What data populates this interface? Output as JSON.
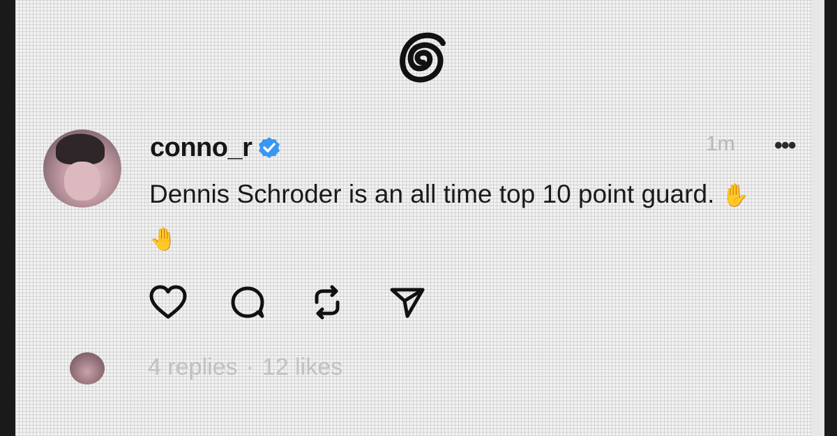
{
  "post": {
    "username": "conno_r",
    "verified": true,
    "timestamp": "1m",
    "more_label": "•••",
    "text": "Dennis Schroder is an all time top 10 point guard.",
    "emojis": "✋🤚",
    "replies": "4 replies",
    "separator": "·",
    "likes": "12 likes"
  },
  "icons": {
    "logo": "threads-logo-icon",
    "verified": "verified-badge-icon",
    "actions": [
      "heart-icon",
      "comment-icon",
      "repost-icon",
      "share-icon"
    ]
  },
  "colors": {
    "verified_badge": "#3897f0",
    "text": "#1a1a1a",
    "muted": "#c1c1c1"
  }
}
